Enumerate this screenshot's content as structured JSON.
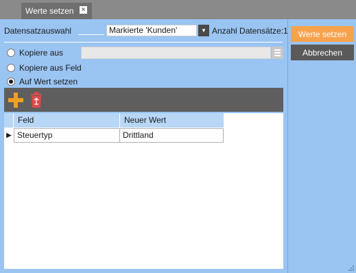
{
  "tab": {
    "title": "Werte setzen",
    "close_glyph": "×"
  },
  "header": {
    "datensatzauswahl_label": "Datensatzauswahl",
    "selection_value": "Markierte 'Kunden'",
    "anzahl_label": "Anzahl Datensätze:",
    "anzahl_value": "1"
  },
  "options": {
    "kopiere_aus": "Kopiere aus",
    "kopiere_aus_feld": "Kopiere aus Feld",
    "auf_wert_setzen": "Auf Wert setzen",
    "selected": "auf_wert_setzen"
  },
  "toolbar": {
    "add_icon": "plus-icon",
    "delete_icon": "recycle-bin-icon"
  },
  "grid": {
    "columns": [
      "Feld",
      "Neuer Wert"
    ],
    "rows": [
      {
        "feld": "Steuertyp",
        "neuer_wert": "Drittland"
      }
    ]
  },
  "actions": {
    "primary_label": "Werte setzen",
    "secondary_label": "Abbrechen"
  },
  "colors": {
    "background": "#9ac4f2",
    "primary_button": "#f7a24c",
    "secondary_button": "#5a5a5a",
    "toolbar": "#5e5e5e",
    "accent_icon": "#f0a020",
    "delete_icon": "#e04848"
  }
}
